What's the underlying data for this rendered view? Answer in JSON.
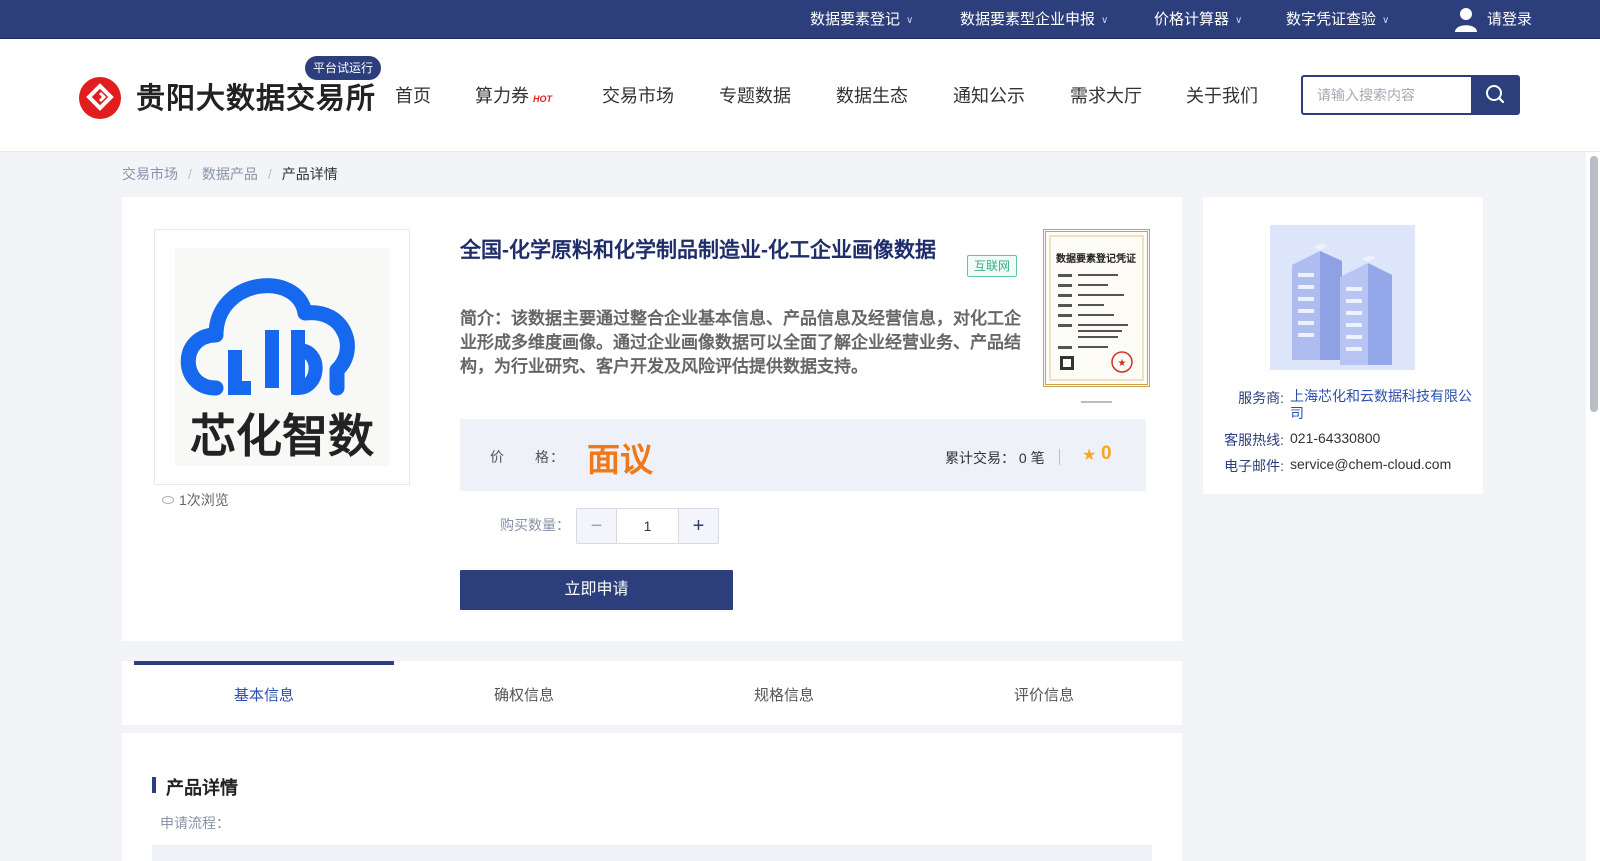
{
  "topbar": {
    "links": [
      "数据要素登记",
      "数据要素型企业申报",
      "价格计算器",
      "数字凭证查验"
    ],
    "login": "请登录"
  },
  "header": {
    "site_title": "贵阳大数据交易所",
    "badge": "平台试运行",
    "nav": [
      "首页",
      "算力券",
      "交易市场",
      "专题数据",
      "数据生态",
      "通知公示",
      "需求大厅",
      "关于我们"
    ],
    "hot_label": "HOT",
    "search_placeholder": "请输入搜索内容"
  },
  "breadcrumb": [
    "交易市场",
    "数据产品",
    "产品详情"
  ],
  "product": {
    "logo_text": "芯化智数",
    "views": "1次浏览",
    "title": "全国-化学原料和化学制品制造业-化工企业画像数据",
    "tag": "互联网",
    "description": "简介：该数据主要通过整合企业基本信息、产品信息及经营信息，对化工企业形成多维度画像。通过企业画像数据可以全面了解企业经营业务、产品结构，为行业研究、客户开发及风险评估提供数据支持。",
    "certificate_title": "数据要素登记凭证",
    "price_label": "价　　格：",
    "price": "面议",
    "trade_label": "累计交易：",
    "trade_count": "0 笔",
    "rating": "0",
    "quantity_label": "购买数量：",
    "quantity": "1",
    "apply_button": "立即申请"
  },
  "service": {
    "provider_label": "服务商:",
    "provider": "上海芯化和云数据科技有限公司",
    "hotline_label": "客服热线:",
    "hotline": "021-64330800",
    "email_label": "电子邮件:",
    "email": "service@chem-cloud.com"
  },
  "tabs": [
    "基本信息",
    "确权信息",
    "规格信息",
    "评价信息"
  ],
  "details": {
    "title": "产品详情",
    "flow_label": "申请流程："
  },
  "colors": {
    "primary": "#2c3e7c",
    "price": "#f07819",
    "logo_red": "#e21d1d",
    "cloud_blue": "#1668ee",
    "tag_green": "#39ad88"
  }
}
